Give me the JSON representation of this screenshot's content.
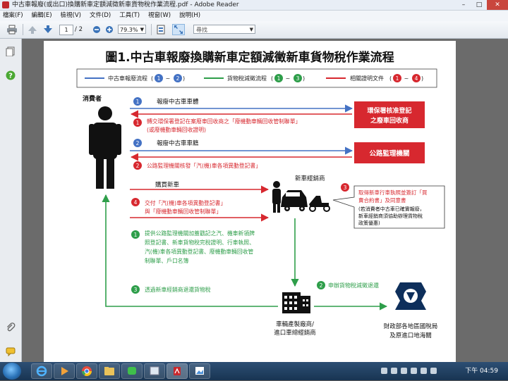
{
  "window": {
    "title": "中古車報廢(或出口)換購新車定額減徵新車貨物稅作業流程.pdf - Adobe Reader",
    "minimize": "–",
    "maximize": "□",
    "close": "✕"
  },
  "menu": [
    "檔案(F)",
    "編輯(E)",
    "檢視(V)",
    "文件(D)",
    "工具(T)",
    "視窗(W)",
    "說明(H)"
  ],
  "toolbar": {
    "page_current": "1",
    "page_total": "/ 2",
    "zoom": "79.3%",
    "search_placeholder": "尋找"
  },
  "diagram": {
    "title": "圖1.中古車報廢換購新車定額減徵新車貨物稅作業流程",
    "legend": [
      {
        "label": "中古車報廢流程",
        "from": "1",
        "to": "2",
        "color": "#4472c4"
      },
      {
        "label": "貨物稅減徵流程",
        "from": "1",
        "to": "3",
        "color": "#2e9e4a"
      },
      {
        "label": "相關證明文件",
        "from": "1",
        "to": "4",
        "color": "#d7282f"
      }
    ],
    "legend_sep": "~",
    "consumer": "消費者",
    "epa_box": [
      "環保署核准登記",
      "之廢車回收商"
    ],
    "dmv_box": "公路監理機關",
    "dealer": "新車經銷商",
    "maker": [
      "車輛產製廠商/",
      "進口車總經銷商"
    ],
    "tax_office": [
      "財政部各地區國稅局",
      "及原進口地海關"
    ],
    "steps": {
      "blue1_num": "1",
      "blue1_text": "報廢中古車車體",
      "red1_num": "1",
      "red1_lines": [
        "轉交環保署登記在案廢車回收商之「廢機動車輛回收管制聯單」",
        "(或廢機動車輛回收證明)"
      ],
      "blue2_num": "2",
      "blue2_text": "報廢中古車車籍",
      "red2_num": "2",
      "red2_text": "公路監理機關核發「汽(機)車各項異動登記書」",
      "buy_text": "購買新車",
      "red4_num": "4",
      "red4_lines": [
        "交付「汽(機)車各項異動登記書」",
        "與「廢機動車輛回收管制聯單」"
      ],
      "red3_num": "3",
      "red3_lines": [
        "取得新車行車執照並簽訂「買",
        "賣合約書」及同意書"
      ],
      "red3_note": [
        "(若消費者中古車已確實報廢，",
        "新車經銷商須協助辦理貨物稅",
        "政策優惠)"
      ],
      "green1_num": "1",
      "green1_lines": [
        "提供公路監理機關加蓋戳記之汽、機車新領牌",
        "照登記書、新車貨物稅完稅證明、行車執照、",
        "汽(機)車各項異動登記書、廢機動車輛回收管",
        "制聯單、戶口名簿"
      ],
      "green2_num": "2",
      "green2_text": "申辦貨物稅減徵退還",
      "green3_num": "3",
      "green3_text": "透過新車經銷商退還貨物稅"
    },
    "colors": {
      "blue": "#4472c4",
      "red": "#d7282f",
      "green": "#2e9e4a"
    }
  },
  "taskbar": {
    "clock": "下午 04:59"
  }
}
